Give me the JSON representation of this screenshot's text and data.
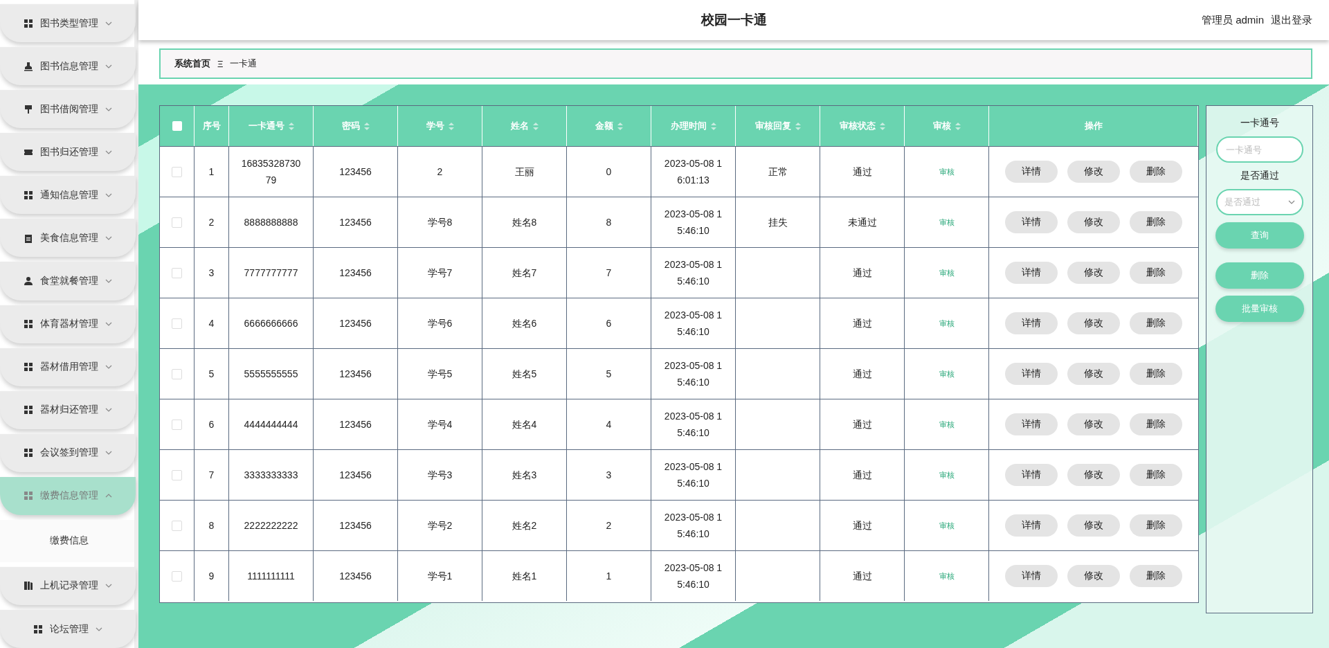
{
  "header": {
    "title": "校园一卡通",
    "user": "管理员 admin",
    "logout": "退出登录"
  },
  "sidebar": {
    "items": [
      {
        "label": "图书类型管理",
        "kind": "grid",
        "expanded": false
      },
      {
        "label": "图书信息管理",
        "kind": "stamp",
        "expanded": false
      },
      {
        "label": "图书借阅管理",
        "kind": "brush",
        "expanded": false
      },
      {
        "label": "图书归还管理",
        "kind": "ticket",
        "expanded": false
      },
      {
        "label": "通知信息管理",
        "kind": "grid",
        "expanded": false
      },
      {
        "label": "美食信息管理",
        "kind": "clipboard",
        "expanded": false
      },
      {
        "label": "食堂就餐管理",
        "kind": "person",
        "expanded": false
      },
      {
        "label": "体育器材管理",
        "kind": "grid",
        "expanded": false
      },
      {
        "label": "器材借用管理",
        "kind": "grid",
        "expanded": false
      },
      {
        "label": "器材归还管理",
        "kind": "grid",
        "expanded": false
      },
      {
        "label": "会议签到管理",
        "kind": "grid",
        "expanded": false
      },
      {
        "label": "缴费信息管理",
        "kind": "grid",
        "expanded": true,
        "children": [
          {
            "label": "缴费信息"
          }
        ]
      },
      {
        "label": "上机记录管理",
        "kind": "book",
        "expanded": false
      },
      {
        "label": "论坛管理",
        "kind": "grid",
        "expanded": false
      }
    ]
  },
  "breadcrumb": {
    "home": "系统首页",
    "separator": "Ξ",
    "current": "一卡通"
  },
  "table": {
    "select_all": {
      "checked": false
    },
    "columns": [
      {
        "label": "序号",
        "sortable": false
      },
      {
        "label": "一卡通号",
        "sortable": true
      },
      {
        "label": "密码",
        "sortable": true
      },
      {
        "label": "学号",
        "sortable": true
      },
      {
        "label": "姓名",
        "sortable": true
      },
      {
        "label": "金额",
        "sortable": true
      },
      {
        "label": "办理时间",
        "sortable": true
      },
      {
        "label": "审核回复",
        "sortable": true
      },
      {
        "label": "审核状态",
        "sortable": true
      },
      {
        "label": "审核",
        "sortable": true
      },
      {
        "label": "操作",
        "sortable": false
      }
    ],
    "rows": [
      {
        "selected": false,
        "no": "1",
        "card": "1683532873079",
        "password": "123456",
        "student_no": "2",
        "name": "王丽",
        "amount": "0",
        "time": "2023-05-08 16:01:13",
        "reply": "正常",
        "status": "通过",
        "review": "审核",
        "actions": [
          "详情",
          "修改",
          "删除"
        ]
      },
      {
        "selected": false,
        "no": "2",
        "card": "8888888888",
        "password": "123456",
        "student_no": "学号8",
        "name": "姓名8",
        "amount": "8",
        "time": "2023-05-08 15:46:10",
        "reply": "挂失",
        "status": "未通过",
        "review": "审核",
        "actions": [
          "详情",
          "修改",
          "删除"
        ]
      },
      {
        "selected": false,
        "no": "3",
        "card": "7777777777",
        "password": "123456",
        "student_no": "学号7",
        "name": "姓名7",
        "amount": "7",
        "time": "2023-05-08 15:46:10",
        "status": "通过",
        "review": "审核",
        "actions": [
          "详情",
          "修改",
          "删除"
        ]
      },
      {
        "selected": false,
        "no": "4",
        "card": "6666666666",
        "password": "123456",
        "student_no": "学号6",
        "name": "姓名6",
        "amount": "6",
        "time": "2023-05-08 15:46:10",
        "status": "通过",
        "review": "审核",
        "actions": [
          "详情",
          "修改",
          "删除"
        ]
      },
      {
        "selected": false,
        "no": "5",
        "card": "5555555555",
        "password": "123456",
        "student_no": "学号5",
        "name": "姓名5",
        "amount": "5",
        "time": "2023-05-08 15:46:10",
        "status": "通过",
        "review": "审核",
        "actions": [
          "详情",
          "修改",
          "删除"
        ]
      },
      {
        "selected": false,
        "no": "6",
        "card": "4444444444",
        "password": "123456",
        "student_no": "学号4",
        "name": "姓名4",
        "amount": "4",
        "time": "2023-05-08 15:46:10",
        "status": "通过",
        "review": "审核",
        "actions": [
          "详情",
          "修改",
          "删除"
        ]
      },
      {
        "selected": false,
        "no": "7",
        "card": "3333333333",
        "password": "123456",
        "student_no": "学号3",
        "name": "姓名3",
        "amount": "3",
        "time": "2023-05-08 15:46:10",
        "status": "通过",
        "review": "审核",
        "actions": [
          "详情",
          "修改",
          "删除"
        ]
      },
      {
        "selected": false,
        "no": "8",
        "card": "2222222222",
        "password": "123456",
        "student_no": "学号2",
        "name": "姓名2",
        "amount": "2",
        "time": "2023-05-08 15:46:10",
        "status": "通过",
        "review": "审核",
        "actions": [
          "详情",
          "修改",
          "删除"
        ]
      },
      {
        "selected": false,
        "no": "9",
        "card": "1111111111",
        "password": "123456",
        "student_no": "学号1",
        "name": "姓名1",
        "amount": "1",
        "time": "2023-05-08 15:46:10",
        "status": "通过",
        "review": "审核",
        "actions": [
          "详情",
          "修改",
          "删除"
        ]
      }
    ]
  },
  "search_panel": {
    "card_label": "一卡通号",
    "card_placeholder": "一卡通号",
    "pass_label": "是否通过",
    "pass_placeholder": "是否通过",
    "buttons": [
      "查询",
      "删除",
      "批量审核"
    ]
  }
}
